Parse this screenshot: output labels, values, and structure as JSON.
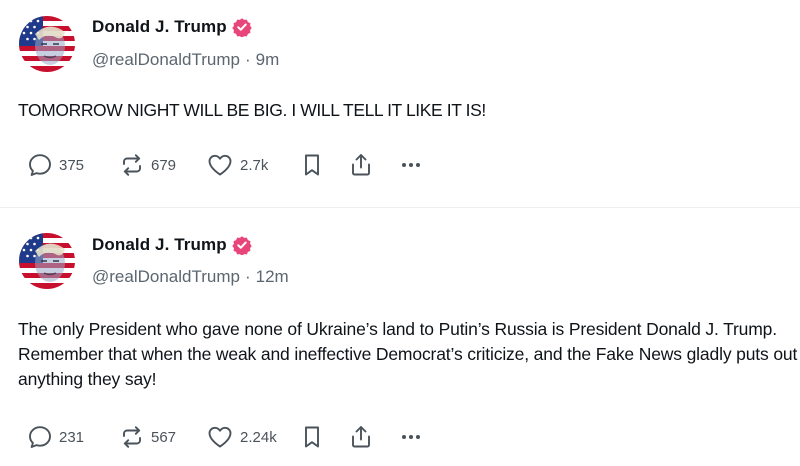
{
  "posts": [
    {
      "author": "Donald J. Trump",
      "handle": "@realDonaldTrump",
      "separator": "·",
      "time": "9m",
      "text": "TOMORROW NIGHT WILL BE BIG. I WILL TELL IT LIKE IT IS!",
      "replies": "375",
      "reposts": "679",
      "likes": "2.7k"
    },
    {
      "author": "Donald J. Trump",
      "handle": "@realDonaldTrump",
      "separator": "·",
      "time": "12m",
      "text": "The only President who gave none of Ukraine’s land to Putin’s Russia is President Donald J. Trump. Remember that when the weak and ineffective Democrat’s criticize, and the Fake News gladly puts out anything they say!",
      "replies": "231",
      "reposts": "567",
      "likes": "2.24k"
    }
  ],
  "icons": {
    "reply": "reply-icon",
    "repost": "repost-icon",
    "like": "heart-icon",
    "bookmark": "bookmark-icon",
    "share": "share-icon",
    "more": "more-icon",
    "verified": "verified-badge-icon"
  },
  "colors": {
    "verified_badge": "#e8457a",
    "text": "#0f1419",
    "secondary_text": "#5b6670",
    "icon": "#4a525a",
    "flag_red": "#c8102e",
    "flag_blue": "#1f3a8a"
  }
}
